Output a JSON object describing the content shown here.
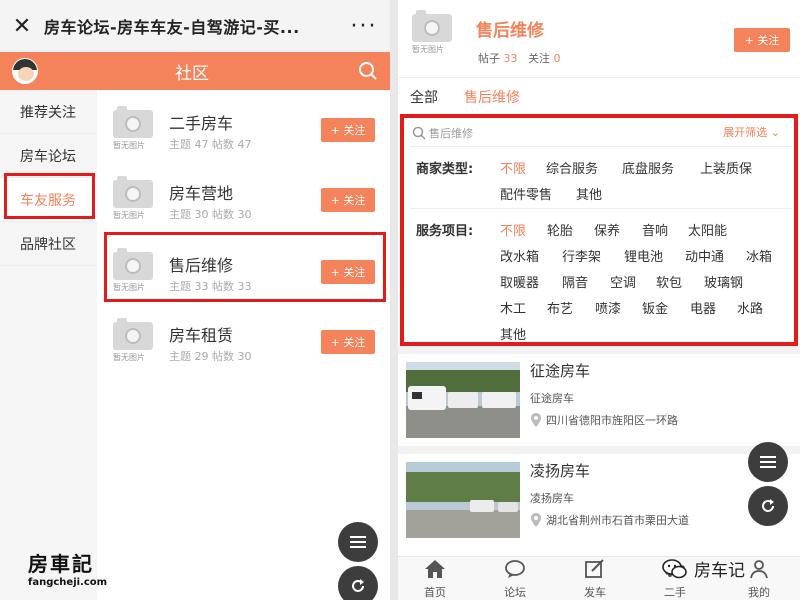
{
  "left": {
    "window_title": "房车论坛-房车车友-自驾游记-买...",
    "header_title": "社区",
    "sidebar": [
      {
        "label": "推荐关注"
      },
      {
        "label": "房车论坛"
      },
      {
        "label": "车友服务"
      },
      {
        "label": "品牌社区"
      }
    ],
    "placeholder_text": "暂无图片",
    "categories": [
      {
        "name": "二手房车",
        "meta": "主题 47   帖数 47",
        "follow": "+ 关注"
      },
      {
        "name": "房车营地",
        "meta": "主题 30   帖数 30",
        "follow": "+ 关注"
      },
      {
        "name": "售后维修",
        "meta": "主题 33   帖数 33",
        "follow": "+ 关注"
      },
      {
        "name": "房车租赁",
        "meta": "主题 29   帖数 30",
        "follow": "+ 关注"
      }
    ],
    "watermark": {
      "title": "房車記",
      "url": "fangcheji.com"
    }
  },
  "right": {
    "placeholder_text": "暂无图片",
    "title": "售后维修",
    "posts_label": "帖子",
    "posts_count": "33",
    "follows_label": "关注",
    "follows_count": "0",
    "follow_button": "+ 关注",
    "tabs": [
      {
        "label": "全部"
      },
      {
        "label": "售后维修"
      }
    ],
    "filter": {
      "search_placeholder": "售后维修",
      "expand_label": "展开筛选",
      "merchant_label": "商家类型:",
      "merchant_options": [
        "不限",
        "综合服务",
        "底盘服务",
        "上装质保",
        "配件零售",
        "其他"
      ],
      "service_label": "服务项目:",
      "service_options": [
        "不限",
        "轮胎",
        "保养",
        "音响",
        "太阳能",
        "改水箱",
        "行李架",
        "锂电池",
        "动中通",
        "冰箱",
        "取暖器",
        "隔音",
        "空调",
        "软包",
        "玻璃钢",
        "木工",
        "布艺",
        "喷漆",
        "钣金",
        "电器",
        "水路",
        "其他"
      ]
    },
    "shops": [
      {
        "name": "征途房车",
        "sub": "征途房车",
        "address": "四川省德阳市旌阳区一环路"
      },
      {
        "name": "凌扬房车",
        "sub": "凌扬房车",
        "address": "湖北省荆州市石首市栗田大道"
      }
    ],
    "tabbar": [
      {
        "label": "首页",
        "icon": "home-icon"
      },
      {
        "label": "论坛",
        "icon": "chat-icon"
      },
      {
        "label": "发车",
        "icon": "edit-icon"
      },
      {
        "label": "二手",
        "icon": "car-icon"
      },
      {
        "label": "我的",
        "icon": "user-icon"
      }
    ],
    "wechat_source": "房车记"
  },
  "colors": {
    "accent": "#f4825a",
    "highlight_box": "#e31b1b",
    "fab": "#3d3d3d"
  }
}
